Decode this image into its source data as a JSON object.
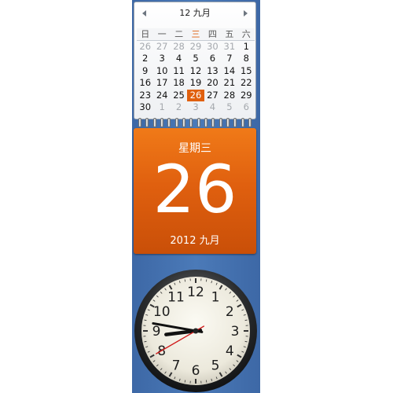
{
  "calendar": {
    "title": "12 九月",
    "weekdays": [
      "日",
      "一",
      "二",
      "三",
      "四",
      "五",
      "六"
    ],
    "today_weekday_index": 3,
    "weeks": [
      [
        {
          "d": "26",
          "m": true
        },
        {
          "d": "27",
          "m": true
        },
        {
          "d": "28",
          "m": true
        },
        {
          "d": "29",
          "m": true
        },
        {
          "d": "30",
          "m": true
        },
        {
          "d": "31",
          "m": true
        },
        {
          "d": "1"
        }
      ],
      [
        {
          "d": "2"
        },
        {
          "d": "3"
        },
        {
          "d": "4"
        },
        {
          "d": "5"
        },
        {
          "d": "6"
        },
        {
          "d": "7"
        },
        {
          "d": "8"
        }
      ],
      [
        {
          "d": "9"
        },
        {
          "d": "10"
        },
        {
          "d": "11"
        },
        {
          "d": "12"
        },
        {
          "d": "13"
        },
        {
          "d": "14"
        },
        {
          "d": "15"
        }
      ],
      [
        {
          "d": "16"
        },
        {
          "d": "17"
        },
        {
          "d": "18"
        },
        {
          "d": "19"
        },
        {
          "d": "20"
        },
        {
          "d": "21"
        },
        {
          "d": "22"
        }
      ],
      [
        {
          "d": "23"
        },
        {
          "d": "24"
        },
        {
          "d": "25"
        },
        {
          "d": "26",
          "today": true
        },
        {
          "d": "27"
        },
        {
          "d": "28"
        },
        {
          "d": "29"
        }
      ],
      [
        {
          "d": "30"
        },
        {
          "d": "1",
          "m": true
        },
        {
          "d": "2",
          "m": true
        },
        {
          "d": "3",
          "m": true
        },
        {
          "d": "4",
          "m": true
        },
        {
          "d": "5",
          "m": true
        },
        {
          "d": "6",
          "m": true
        }
      ]
    ]
  },
  "daycard": {
    "weekday": "星期三",
    "day": "26",
    "year_month": "2012 九月"
  },
  "clock": {
    "hour": 8,
    "minute": 46,
    "second": 40,
    "numbers": [
      "12",
      "1",
      "2",
      "3",
      "4",
      "5",
      "6",
      "7",
      "8",
      "9",
      "10",
      "11"
    ]
  },
  "colors": {
    "accent": "#e0600f",
    "background_strip": "#4b7ab8",
    "second_hand": "#d01a1a"
  }
}
